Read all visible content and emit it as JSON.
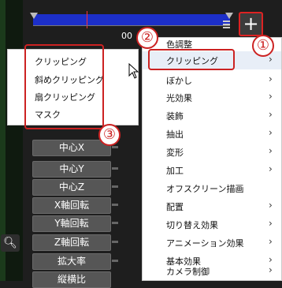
{
  "timeline": {
    "timecode_partial": "00"
  },
  "toolbar": {
    "add_label": "+"
  },
  "params": [
    "中心X",
    "中心Y",
    "中心Z",
    "X軸回転",
    "Y軸回転",
    "Z軸回転",
    "拡大率",
    "縦横比"
  ],
  "menu": {
    "items": [
      {
        "label": "色調整",
        "has_submenu": false
      },
      {
        "label": "クリッピング",
        "has_submenu": true
      },
      {
        "label": "ぼかし",
        "has_submenu": true
      },
      {
        "label": "光効果",
        "has_submenu": true
      },
      {
        "label": "装飾",
        "has_submenu": true
      },
      {
        "label": "抽出",
        "has_submenu": true
      },
      {
        "label": "変形",
        "has_submenu": true
      },
      {
        "label": "加工",
        "has_submenu": true
      },
      {
        "label": "オフスクリーン描画",
        "has_submenu": false
      },
      {
        "label": "配置",
        "has_submenu": true
      },
      {
        "label": "切り替え効果",
        "has_submenu": true
      },
      {
        "label": "アニメーション効果",
        "has_submenu": true
      },
      {
        "label": "基本効果",
        "has_submenu": true
      },
      {
        "label": "カメラ制御",
        "has_submenu": true
      }
    ],
    "chevron": "›"
  },
  "submenu": {
    "items": [
      "クリッピング",
      "斜めクリッピング",
      "扇クリッピング",
      "マスク"
    ]
  },
  "callouts": [
    "①",
    "②",
    "③"
  ],
  "colors": {
    "highlight_red": "#cc2222",
    "timeline_blue": "#1c2fc9"
  }
}
